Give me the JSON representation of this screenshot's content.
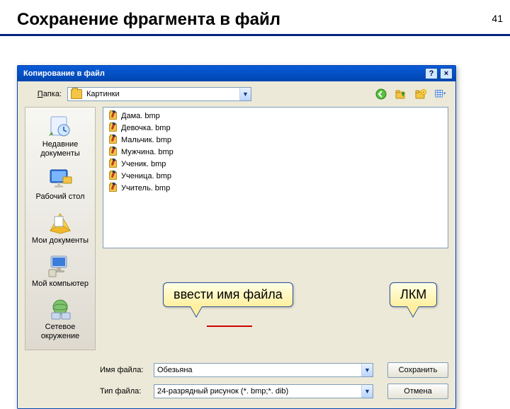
{
  "slide": {
    "number": "41",
    "title": "Сохранение фрагмента в файл"
  },
  "dialog": {
    "title": "Копирование в файл",
    "help_btn": "?",
    "close_btn": "×",
    "folder_label": "Папка:",
    "folder_label_u": "П",
    "folder_name": "Картинки",
    "icons": {
      "back": "back-icon",
      "up": "up-icon",
      "new": "new-folder-icon",
      "views": "views-icon"
    },
    "places": [
      {
        "name": "recent",
        "label": "Недавние документы"
      },
      {
        "name": "desktop",
        "label": "Рабочий стол"
      },
      {
        "name": "mydocs",
        "label": "Мои документы"
      },
      {
        "name": "mycomputer",
        "label": "Мой компьютер"
      },
      {
        "name": "network",
        "label": "Сетевое окружение"
      }
    ],
    "files": [
      {
        "label": "Дама. bmp"
      },
      {
        "label": "Девочка. bmp"
      },
      {
        "label": "Мальчик. bmp"
      },
      {
        "label": "Мужчина. bmp"
      },
      {
        "label": "Ученик. bmp"
      },
      {
        "label": "Ученица. bmp"
      },
      {
        "label": "Учитель. bmp"
      }
    ],
    "filename_label": "Имя файла:",
    "filetype_label": "Тип файла:",
    "filename_value": "Обезьяна",
    "filetype_value": "24-разрядный рисунок (*. bmp;*. dib)",
    "save_btn": "Сохранить",
    "cancel_btn": "Отмена"
  },
  "callouts": {
    "filename": "ввести имя файла",
    "lkm": "ЛКМ"
  }
}
